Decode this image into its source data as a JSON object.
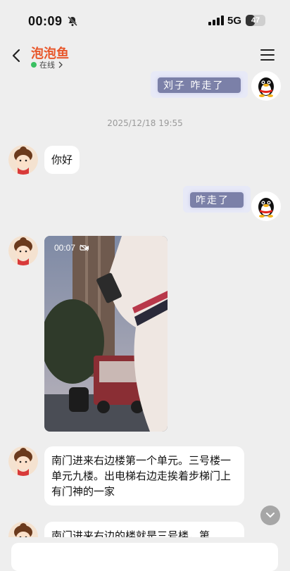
{
  "status_bar": {
    "time": "00:09",
    "network": "5G",
    "battery": "47",
    "battery_level": 0.47,
    "icons": [
      "bell-mute-icon",
      "signal-icon",
      "battery-icon"
    ]
  },
  "header": {
    "title": "泡泡鱼",
    "status": "在线",
    "icons": [
      "back-icon",
      "chevron-right-icon",
      "menu-icon"
    ]
  },
  "messages": [
    {
      "side": "right",
      "type": "sticker",
      "text": "刘子 咋走了"
    },
    {
      "side": "center",
      "type": "timestamp",
      "text": "2025/12/18 19:55"
    },
    {
      "side": "left",
      "type": "text",
      "text": "你好"
    },
    {
      "side": "right",
      "type": "sticker",
      "text": "咋走了"
    },
    {
      "side": "left",
      "type": "video",
      "duration": "00:07"
    },
    {
      "side": "left",
      "type": "text",
      "text": "南门进来右边楼第一个单元。三号楼一单元九楼。出电梯右边走挨着步梯门上有门神的一家"
    },
    {
      "side": "left",
      "type": "text",
      "text": "南门进来右边的楼就是三号楼，第"
    }
  ],
  "colors": {
    "title": "#e8572b",
    "online_dot": "#3ac062",
    "background": "#eeeeee"
  }
}
